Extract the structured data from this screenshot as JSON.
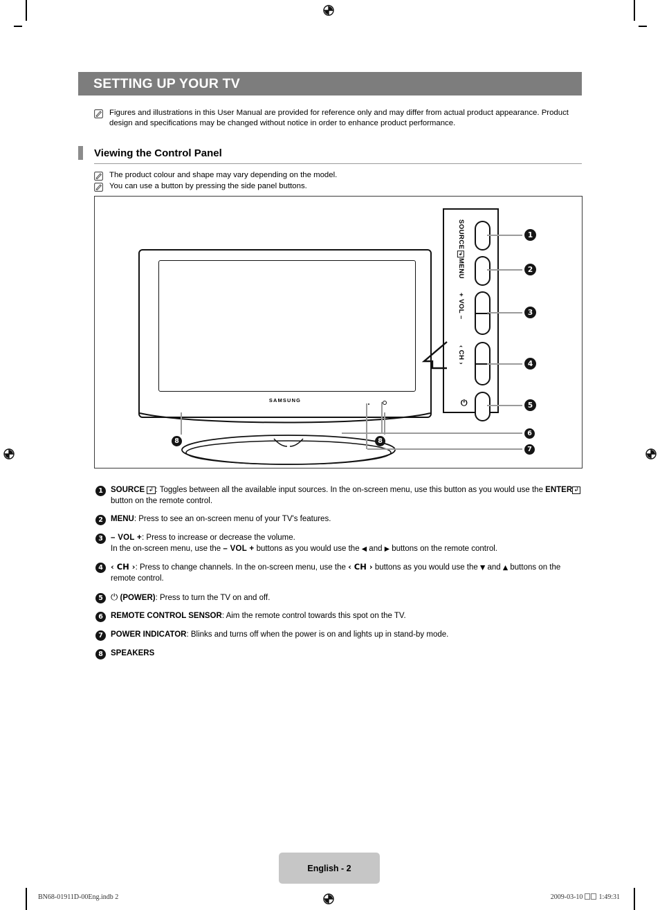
{
  "document": {
    "chapter_title": "SETTING UP YOUR TV",
    "section_title": "Viewing the Control Panel",
    "page_label": "English - 2",
    "footer_left": "BN68-01911D-00Eng.indb   2",
    "footer_date": "2009-03-10",
    "footer_time": "1:49:31",
    "header_bar_color": "#7d7d7d",
    "page_tab_color": "#c6c6c6",
    "accent_tick_color": "#8c8c8c",
    "leader_line_color": "#9a9a9a",
    "bullet_color": "#151515"
  },
  "intro_notes": [
    "Figures and illustrations in this User Manual are provided for reference only and may differ from actual product appearance. Product design and specifications may be changed without notice in order to enhance product performance."
  ],
  "panel_notes": [
    "The product colour and shape may vary depending on the model.",
    "You can use a button by pressing the side panel buttons."
  ],
  "diagram": {
    "brand_logo": "SAMSUNG",
    "side_panel_buttons": [
      {
        "num": "1",
        "label": "SOURCE",
        "has_enter_icon": true,
        "icon": "enter-return-icon"
      },
      {
        "num": "2",
        "label": "MENU",
        "has_enter_icon": false,
        "icon": ""
      },
      {
        "num": "3",
        "label": "+ VOL –",
        "has_enter_icon": false,
        "icon": ""
      },
      {
        "num": "4",
        "label": "‹ CH ›",
        "has_enter_icon": false,
        "icon": ""
      },
      {
        "num": "5",
        "label": "⏻",
        "has_enter_icon": false,
        "icon": "power-icon"
      }
    ],
    "leader_numbers": [
      "1",
      "2",
      "3",
      "4",
      "5",
      "6",
      "7"
    ],
    "speaker_markers": [
      "8",
      "8"
    ]
  },
  "legend": [
    {
      "num": "1",
      "parts": [
        {
          "t": "bold",
          "v": "SOURCE"
        },
        {
          "t": "kbox",
          "v": "↵"
        },
        {
          "t": "plain",
          "v": ": Toggles between all the available input sources. In the on-screen menu, use this button as you would use the "
        },
        {
          "t": "bold",
          "v": "ENTER"
        },
        {
          "t": "kbox",
          "v": "↵"
        },
        {
          "t": "plain",
          "v": " button on the remote control."
        }
      ]
    },
    {
      "num": "2",
      "parts": [
        {
          "t": "bold",
          "v": "MENU"
        },
        {
          "t": "plain",
          "v": ": Press to see an on-screen menu of your TV's features."
        }
      ]
    },
    {
      "num": "3",
      "parts": [
        {
          "t": "vol",
          "v": "– VOL +"
        },
        {
          "t": "plain",
          "v": ": Press to increase or decrease the volume."
        },
        {
          "t": "br",
          "v": ""
        },
        {
          "t": "plain",
          "v": "In the on-screen menu, use the "
        },
        {
          "t": "vol",
          "v": "– VOL +"
        },
        {
          "t": "plain",
          "v": " buttons as you would use the "
        },
        {
          "t": "arw",
          "v": "◀"
        },
        {
          "t": "plain",
          "v": " and "
        },
        {
          "t": "arw",
          "v": "▶"
        },
        {
          "t": "plain",
          "v": " buttons on the remote control."
        }
      ]
    },
    {
      "num": "4",
      "parts": [
        {
          "t": "chv",
          "v": "‹ CH ›"
        },
        {
          "t": "plain",
          "v": ": Press to change channels. In the on-screen menu, use the "
        },
        {
          "t": "chv",
          "v": "‹ CH ›"
        },
        {
          "t": "plain",
          "v": " buttons as you would use the "
        },
        {
          "t": "arw",
          "v": "▼"
        },
        {
          "t": "plain",
          "v": " and "
        },
        {
          "t": "arw",
          "v": "▲"
        },
        {
          "t": "plain",
          "v": " buttons on the remote control."
        }
      ]
    },
    {
      "num": "5",
      "parts": [
        {
          "t": "pwr",
          "v": "⏻"
        },
        {
          "t": "bold",
          "v": " (POWER)"
        },
        {
          "t": "plain",
          "v": ": Press to turn the TV on and off."
        }
      ]
    },
    {
      "num": "6",
      "parts": [
        {
          "t": "bold",
          "v": "REMOTE CONTROL SENSOR"
        },
        {
          "t": "plain",
          "v": ": Aim the remote control towards this spot on the TV."
        }
      ]
    },
    {
      "num": "7",
      "parts": [
        {
          "t": "bold",
          "v": "POWER INDICATOR"
        },
        {
          "t": "plain",
          "v": ": Blinks and turns off when the power is on and lights up in stand-by mode."
        }
      ]
    },
    {
      "num": "8",
      "parts": [
        {
          "t": "bold",
          "v": "SPEAKERS"
        }
      ]
    }
  ]
}
